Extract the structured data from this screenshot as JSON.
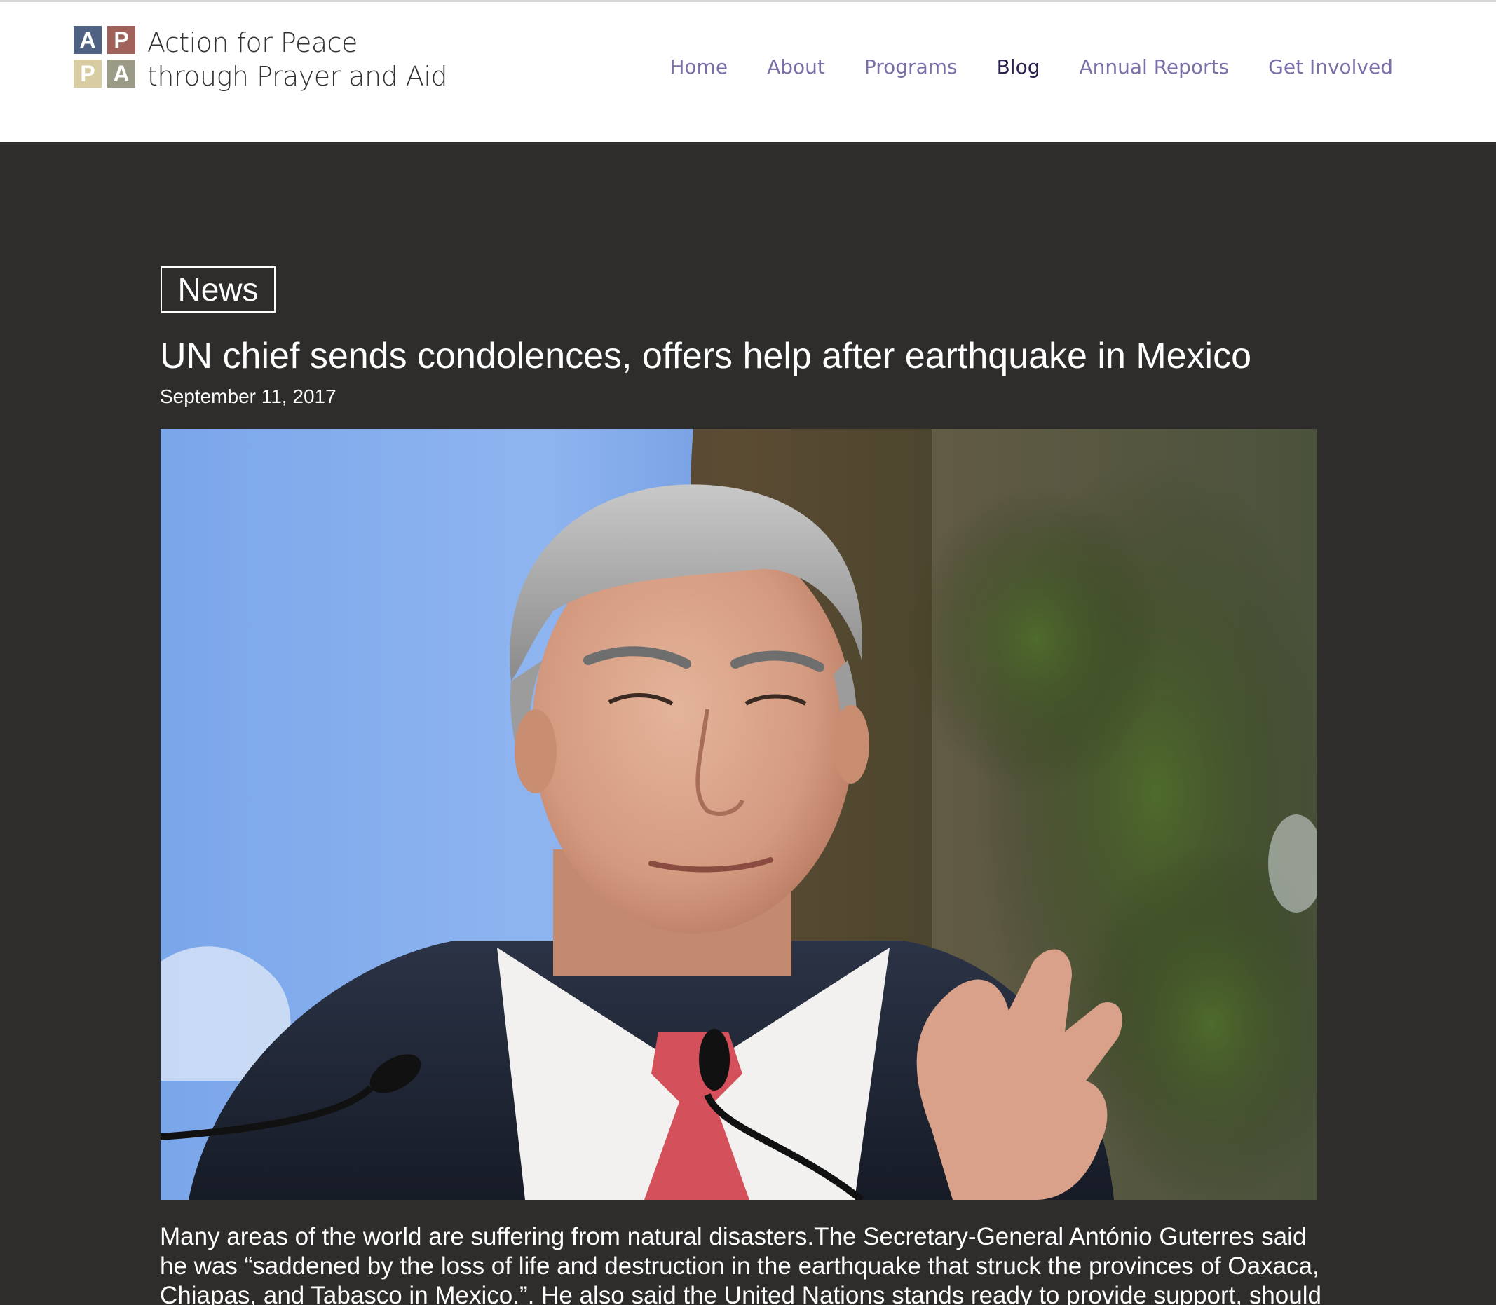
{
  "site": {
    "logo_letters": [
      "A",
      "P",
      "P",
      "A"
    ],
    "logo_line1": "Action for Peace",
    "logo_line2": "through Prayer and Aid"
  },
  "nav": {
    "items": [
      {
        "label": "Home"
      },
      {
        "label": "About"
      },
      {
        "label": "Programs"
      },
      {
        "label": "Blog"
      },
      {
        "label": "Annual Reports"
      },
      {
        "label": "Get Involved"
      }
    ],
    "active": "Blog"
  },
  "article": {
    "category": "News",
    "title": "UN chief sends condolences, offers help after earthquake in Mexico",
    "date": "September 11, 2017",
    "body": "Many areas of the world are suffering from natural disasters.The Secretary-General António Guterres said he was “saddened by the loss of life and destruction in the earthquake that struck the provinces of Oaxaca, Chiapas, and Tabasco in Mexico.”. He also said the United Nations stands ready to provide support, should"
  },
  "colors": {
    "header_bg": "#ffffff",
    "page_bg": "#2e2d2b",
    "nav_link": "#7c6fa8",
    "nav_active": "#2a1f4d",
    "logo_a1": "#4f6283",
    "logo_p1": "#a0615a",
    "logo_p2": "#d8cca2",
    "logo_a2": "#9a9a86"
  }
}
